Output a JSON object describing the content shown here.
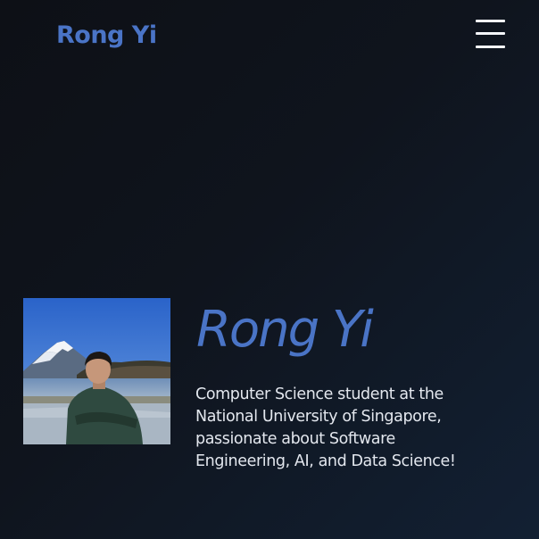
{
  "header": {
    "brand": "Rong Yi",
    "menu_icon": "hamburger-menu-icon"
  },
  "hero": {
    "photo_alt": "Portrait photo of Rong Yi in front of Mount Fuji and a lake",
    "title": "Rong Yi",
    "bio": "Computer Science student at the National University of Singapore, passionate about Software Engineering, AI, and Data Science!"
  },
  "colors": {
    "accent": "#4a74c6",
    "background_start": "#0d1016",
    "background_end": "#122033",
    "text": "#e3e7ee"
  }
}
